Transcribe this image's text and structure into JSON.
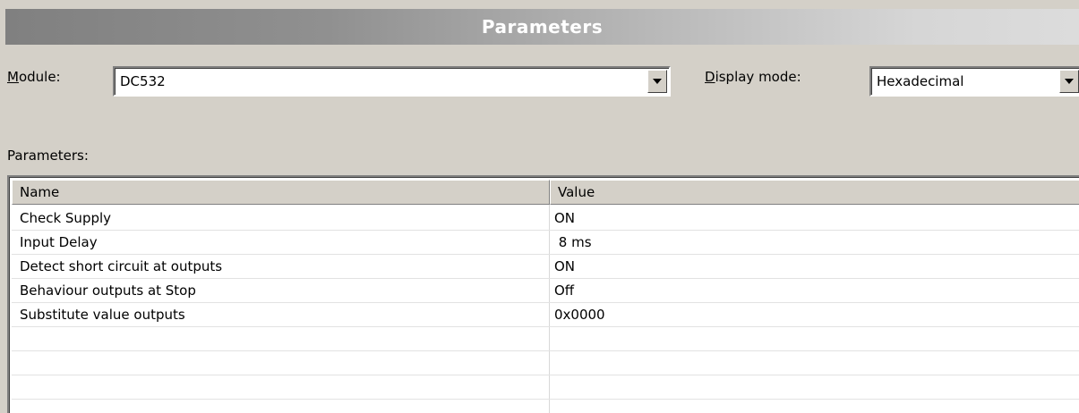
{
  "header": {
    "title": "Parameters"
  },
  "module": {
    "label_prefix": "M",
    "label_rest": "odule:",
    "value": "DC532"
  },
  "display_mode": {
    "label_prefix": "D",
    "label_rest": "isplay mode:",
    "value": "Hexadecimal"
  },
  "parameters_label": "Parameters:",
  "table": {
    "columns": [
      "Name",
      "Value"
    ],
    "rows": [
      {
        "name": "Check Supply",
        "value": "ON"
      },
      {
        "name": "Input Delay",
        "value": " 8 ms"
      },
      {
        "name": "Detect short circuit at outputs",
        "value": "ON"
      },
      {
        "name": "Behaviour outputs at Stop",
        "value": "Off"
      },
      {
        "name": "Substitute value outputs",
        "value": "0x0000"
      },
      {
        "name": "",
        "value": ""
      },
      {
        "name": "",
        "value": ""
      },
      {
        "name": "",
        "value": ""
      }
    ]
  },
  "icons": {
    "dropdown": "chevron-down-icon"
  }
}
